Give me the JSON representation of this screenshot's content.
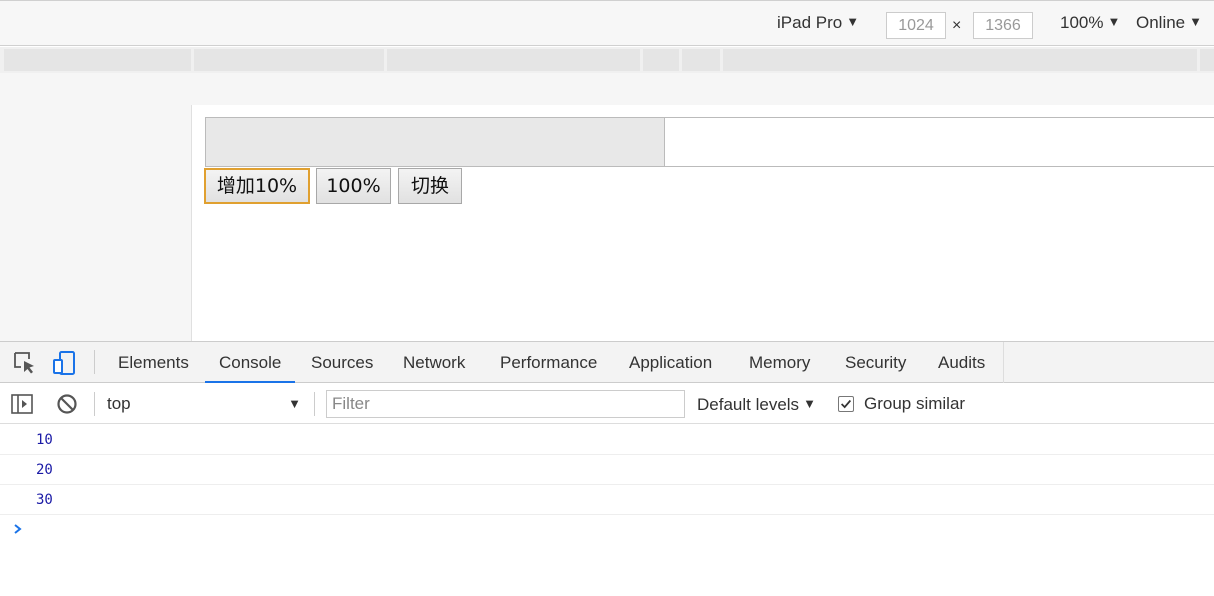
{
  "device_toolbar": {
    "device": "iPad Pro",
    "width": "1024",
    "height": "1366",
    "times": "×",
    "zoom": "100%",
    "network": "Online",
    "arrow": "▼"
  },
  "page": {
    "progress_fraction": 0.45,
    "buttons": [
      "增加10%",
      "100%",
      "切换"
    ]
  },
  "devtools": {
    "tabs": [
      "Elements",
      "Console",
      "Sources",
      "Network",
      "Performance",
      "Application",
      "Memory",
      "Security",
      "Audits"
    ],
    "active_tab": "Console",
    "context": "top",
    "filter_placeholder": "Filter",
    "levels": "Default levels",
    "group_similar": "Group similar",
    "group_similar_checked": true,
    "messages": [
      "10",
      "20",
      "30"
    ],
    "prompt": "›"
  },
  "colors": {
    "accent": "#1a73e8",
    "log_text": "#1a1aa6",
    "focus_outline": "#e0a030"
  }
}
